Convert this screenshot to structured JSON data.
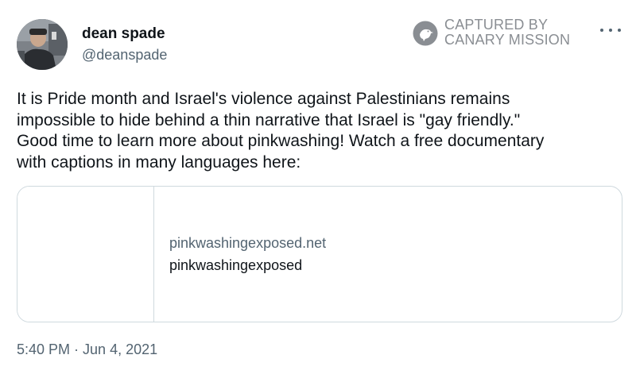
{
  "author": {
    "display_name": "dean spade",
    "handle": "@deanspade"
  },
  "watermark": {
    "line1": "CAPTURED BY",
    "line2": "CANARY MISSION",
    "icon": "canary-bird-logo"
  },
  "menu": {
    "icon": "more-horizontal-icon"
  },
  "tweet": {
    "lines": [
      "It is Pride month and Israel's violence against Palestinians remains",
      "impossible to hide behind a thin narrative that Israel is \"gay friendly.\"",
      "Good time to learn more about pinkwashing! Watch a free documentary",
      "with captions in many languages here:"
    ]
  },
  "link_card": {
    "domain": "pinkwashingexposed.net",
    "title": "pinkwashingexposed"
  },
  "footer": {
    "time": "5:40 PM",
    "separator": " · ",
    "date": "Jun 4, 2021"
  },
  "colors": {
    "text_primary": "#0f1419",
    "text_secondary": "#536471",
    "border": "#cfd9de",
    "watermark": "#8a8e93"
  }
}
